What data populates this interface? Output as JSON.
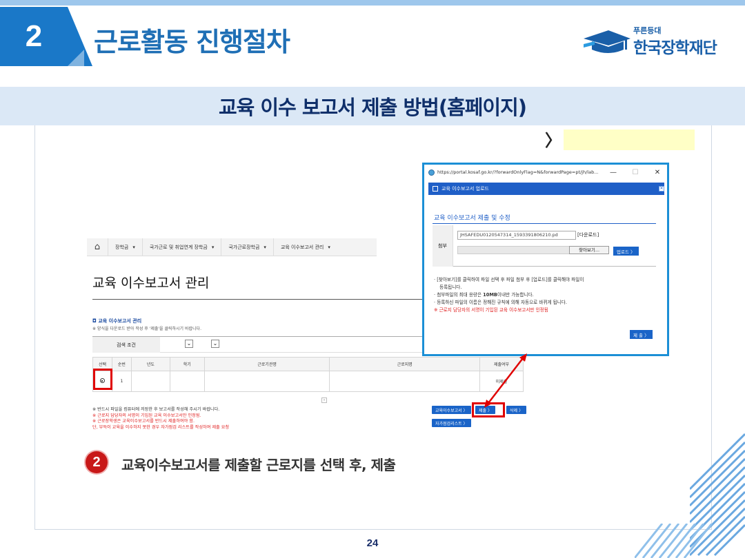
{
  "slide": {
    "section_number": "2",
    "title": "근로활동 진행절차",
    "subtitle": "교육 이수 보고서 제출 방법(홈페이지)",
    "arrow_mark": "〉",
    "page_number": "24"
  },
  "logo": {
    "small_text": "푸른등대",
    "main_text": "한국장학재단"
  },
  "background_page": {
    "nav": {
      "home_icon": "home-icon",
      "crumbs": [
        "장학금",
        "국가근로 및 취업연계 장학금",
        "국가근로장학금",
        "교육 이수보고서 관리"
      ]
    },
    "page_title": "교육 이수보고서 관리",
    "section_title": "◘ 교육 이수보고서 관리",
    "section_note": "※ 양식을 다운로드 받아 작성 후 '제출'을 클릭하시기 바랍니다.",
    "search_label": "검색 조건",
    "table": {
      "headers": [
        "선택",
        "순번",
        "년도",
        "학기",
        "근로기관명",
        "근로지명",
        "제출여부"
      ],
      "rows": [
        [
          "",
          "1",
          "",
          "",
          "",
          "",
          "미제출"
        ]
      ]
    },
    "pager_icon": "»",
    "notes": [
      {
        "text": "※ 반드시 파일을 컴퓨터에 저장한 후 보고서를 작성해 주시기 바랍니다.",
        "color": "dark"
      },
      {
        "text": "※ 근로지 담당자의 서명이 기입된 교육 이수보고서만 인정됨.",
        "color": "red"
      },
      {
        "text": "※ 근로장학생은 교육이수보고서를 반드시 제출하여야 함.",
        "color": "red"
      },
      {
        "text": "   단, 부득이 교육을 이수하지 못한 경우 자가점검 리스트를 작성하여 제출 요청",
        "color": "red"
      }
    ],
    "buttons": {
      "report": "교육이수보고서 〉",
      "submit": "제출 〉",
      "delete": "삭제 〉",
      "checklist": "자가점검리스트 〉"
    }
  },
  "popup": {
    "url": "https://portal.kosaf.go.kr/?forwardOnlyFlag=N&forwardPage=pt/jh/lab...",
    "header": "교육 이수보고서 업로드",
    "sub_title": "교육 이수보고서 제출 및 수정",
    "attach_label": "첨부",
    "file_name": "JHSAFEDU0120547314_1593391806210.pd",
    "download_link": "[다운로드]",
    "browse_button": "찾아보기...",
    "upload_button": "업로드 〉",
    "notes": {
      "n1": "· [찾아보기]를 클릭하여 파일 선택 후 파일 첨부 후 [업로드]를 클릭해야 파일이",
      "n1b": "등록됩니다.",
      "n2a": "· 첨부파일의 최대 용량은 ",
      "n2b": "10MB",
      "n2c": "이내만 가능합니다.",
      "n3": "· 등록하신 파일의 이름은 정해진 규칙에 의해 자동으로 바뀌게 됩니다.",
      "n4": "※ 근로지 담당자의 서명이 기입된 교육 이수보고서만 인정됨"
    },
    "submit_button": "제 출 〉"
  },
  "step": {
    "number": "2",
    "text": "교육이수보고서를 제출할 근로지를 선택 후, 제출"
  },
  "colors": {
    "accent_blue": "#1a78c8",
    "popup_border": "#1b8fd6",
    "highlight_red": "#e00000",
    "band": "#dbe8f6",
    "yellow_box": "#ffffc6"
  }
}
